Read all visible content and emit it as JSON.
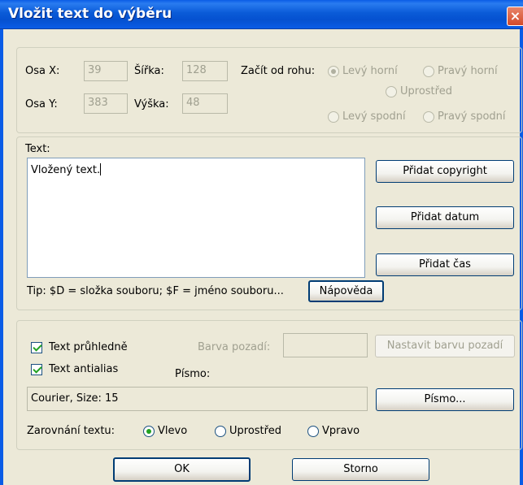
{
  "window": {
    "title": "Vložit text do výběru",
    "close_label": "×"
  },
  "position": {
    "osa_x_label": "Osa X:",
    "osa_x_value": "39",
    "osa_y_label": "Osa Y:",
    "osa_y_value": "383",
    "sirka_label": "Šířka:",
    "sirka_value": "128",
    "vyska_label": "Výška:",
    "vyska_value": "48",
    "corner_label": "Začít od rohu:",
    "corners": {
      "top_left": "Levý horní",
      "top_right": "Pravý horní",
      "center": "Uprostřed",
      "bottom_left": "Levý spodní",
      "bottom_right": "Pravý spodní"
    },
    "selected_corner": "top_left"
  },
  "text_section": {
    "label": "Text:",
    "value": "Vložený text.",
    "tip": "Tip: $D = složka souboru; $F = jméno souboru...",
    "buttons": {
      "add_copyright": "Přidat copyright",
      "add_date": "Přidat datum",
      "add_time": "Přidat čas",
      "help": "Nápověda"
    }
  },
  "options": {
    "transparent_label": "Text průhledně",
    "transparent_checked": true,
    "antialias_label": "Text antialias",
    "antialias_checked": true,
    "bg_color_label": "Barva pozadí:",
    "set_bg_color_button": "Nastavit barvu pozadí",
    "font_label": "Písmo:",
    "font_value": "Courier, Size: 15",
    "font_button": "Písmo...",
    "align_label": "Zarovnání textu:",
    "align": {
      "left": "Vlevo",
      "center": "Uprostřed",
      "right": "Vpravo"
    },
    "selected_align": "left"
  },
  "footer": {
    "ok": "OK",
    "cancel": "Storno"
  }
}
